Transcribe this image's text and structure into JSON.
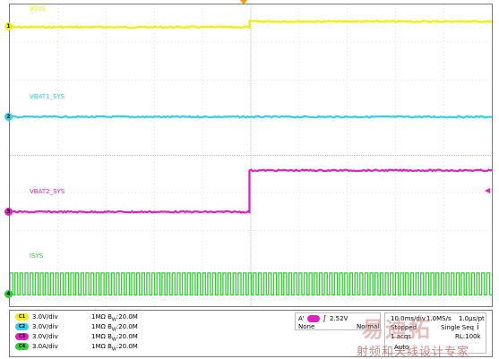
{
  "chart_data": {
    "type": "line",
    "title": "",
    "timebase": {
      "t_div_s": 0.01,
      "divisions": 10,
      "trigger_pos_div": 4.97
    },
    "series": [
      {
        "name": "VSYS",
        "channel": "1",
        "color": "#f0f000",
        "volts_per_div": "3.0V/div",
        "offset_div": 7.4,
        "segments": [
          {
            "t_div": [
              0,
              4.97
            ],
            "level_div": 0.0
          },
          {
            "t_div": [
              4.97,
              10
            ],
            "level_div": 0.15
          }
        ]
      },
      {
        "name": "VBAT1_SYS",
        "channel": "2",
        "color": "#30d0e8",
        "volts_per_div": "3.0V/div",
        "offset_div": 5.0,
        "segments": [
          {
            "t_div": [
              0,
              10
            ],
            "level_div": 0.02
          }
        ]
      },
      {
        "name": "VBAT2_SYS",
        "channel": "3",
        "color": "#e020c0",
        "volts_per_div": "3.0V/div",
        "offset_div": 2.5,
        "segments": [
          {
            "t_div": [
              0,
              4.97
            ],
            "level_div": 0.0
          },
          {
            "t_div": [
              4.97,
              10
            ],
            "level_div": 1.1
          }
        ]
      },
      {
        "name": "ISYS",
        "channel": "4",
        "color": "#30d030",
        "volts_per_div": "3.0A/div",
        "offset_div": 0.3,
        "pulse": {
          "count": 95,
          "high_div": 0.58
        }
      }
    ],
    "channel_rows": [
      {
        "badge": "C1",
        "scale": "3.0V/div",
        "impedance": "1MΩ",
        "bw": "B",
        "bw_sub": "W",
        "bw_val": ":20.0M"
      },
      {
        "badge": "C2",
        "scale": "3.0V/div",
        "impedance": "1MΩ",
        "bw": "B",
        "bw_sub": "W",
        "bw_val": ":20.0M"
      },
      {
        "badge": "C3",
        "scale": "3.0V/div",
        "impedance": "1MΩ",
        "bw": "B",
        "bw_sub": "W",
        "bw_val": ":20.0M"
      },
      {
        "badge": "C4",
        "scale": "3.0A/div",
        "impedance": "1MΩ",
        "bw": "B",
        "bw_sub": "W",
        "bw_val": ":20.0M"
      }
    ],
    "trigger": {
      "label": "A'",
      "level": "2.52V",
      "source": "None",
      "mode": "Normal"
    },
    "acquisition": {
      "timebase": "10.0ms/div",
      "sample_rate": "1.0MS/s",
      "resolution": "1.0μs/pt",
      "state": "Stopped",
      "seq": "Single Seq",
      "acqs": "1 acqs",
      "record_length": "RL:100k",
      "auto": "Auto"
    },
    "watermark_cn": "射频和天线设计专家",
    "watermark_logo": "易迪拓"
  }
}
